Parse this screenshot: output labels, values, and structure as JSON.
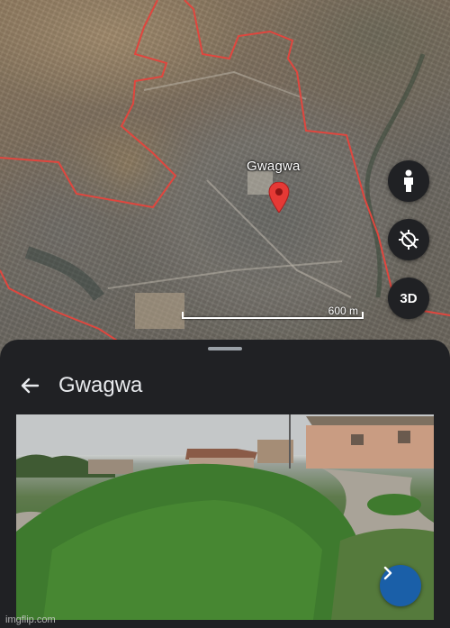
{
  "map": {
    "place_label": "Gwagwa",
    "scale_label": "600 m",
    "boundary_color": "#e0463e",
    "pin_color": "#e53935"
  },
  "controls": {
    "street_view_icon": "person-icon",
    "compass_icon": "location-disabled-icon",
    "three_d_label": "3D"
  },
  "sheet": {
    "back_icon": "arrow-left-icon",
    "title": "Gwagwa",
    "next_icon": "chevron-right-icon",
    "next_button_color": "#1a5fa8"
  },
  "watermark": "imgflip.com"
}
